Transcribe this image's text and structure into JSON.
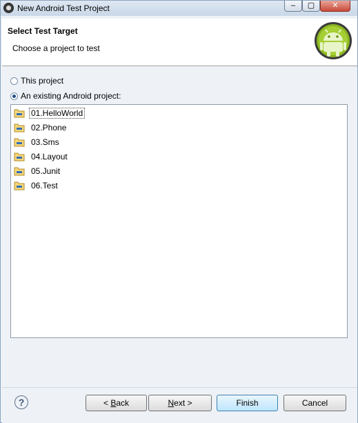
{
  "window": {
    "title": "New Android Test Project"
  },
  "header": {
    "title": "Select Test Target",
    "description": "Choose a project to test"
  },
  "options": [
    {
      "label": "This project",
      "checked": false
    },
    {
      "label": "An existing Android project:",
      "checked": true
    }
  ],
  "projects": [
    "01.HelloWorld",
    "02.Phone",
    "03.Sms",
    "04.Layout",
    "05.Junit",
    "06.Test"
  ],
  "buttons": {
    "back_prefix": "< ",
    "back_accel": "B",
    "back_rest": "ack",
    "next_accel": "N",
    "next_rest": "ext >",
    "finish": "Finish",
    "cancel": "Cancel"
  },
  "help_symbol": "?",
  "colors": {
    "android_green": "#97c024",
    "default_button_border": "#3c7fb1"
  }
}
